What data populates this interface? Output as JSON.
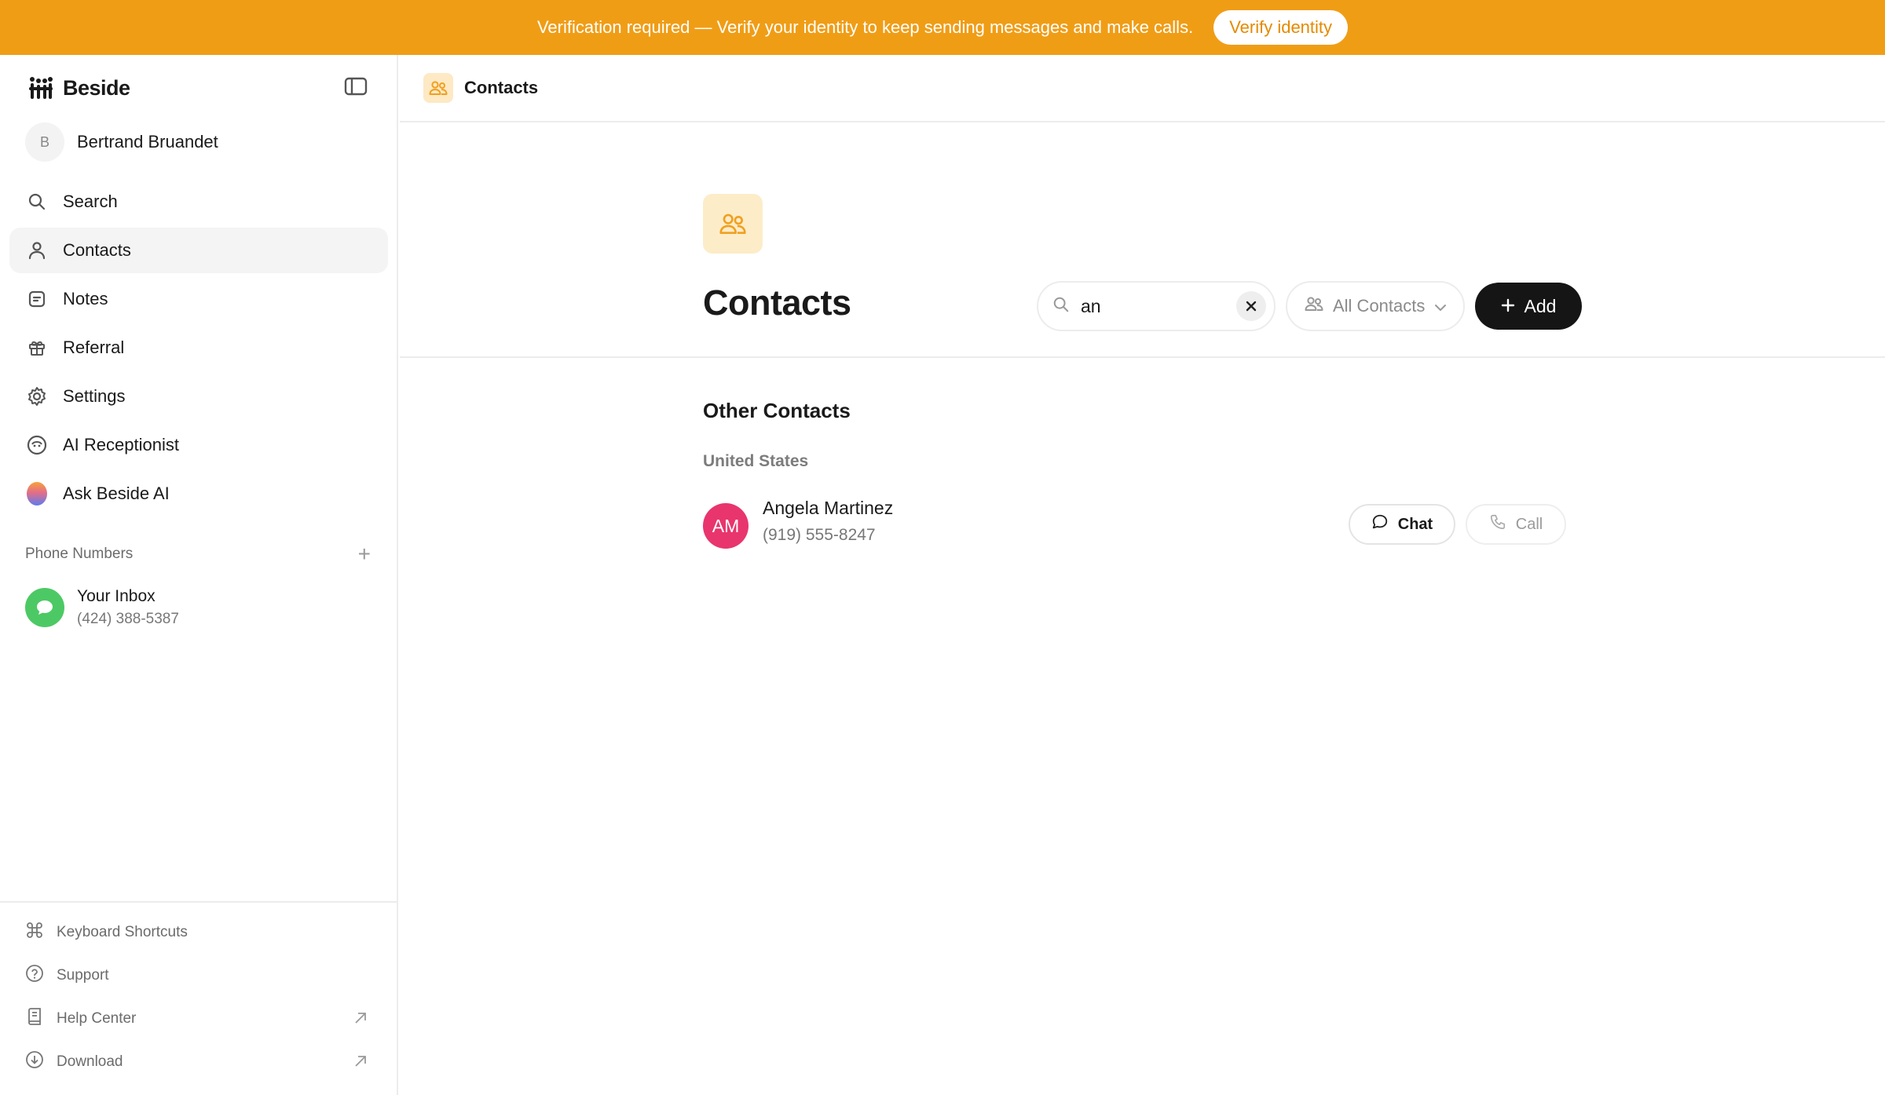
{
  "banner": {
    "text": "Verification required — Verify your identity to keep sending messages and make calls.",
    "button_label": "Verify identity"
  },
  "sidebar": {
    "brand": "Beside",
    "user": {
      "initial": "B",
      "name": "Bertrand Bruandet"
    },
    "items": [
      {
        "label": "Search",
        "icon": "search-icon"
      },
      {
        "label": "Contacts",
        "icon": "person-icon",
        "active": true
      },
      {
        "label": "Notes",
        "icon": "note-icon"
      },
      {
        "label": "Referral",
        "icon": "gift-icon"
      },
      {
        "label": "Settings",
        "icon": "gear-icon"
      },
      {
        "label": "AI Receptionist",
        "icon": "receptionist-icon"
      },
      {
        "label": "Ask Beside AI",
        "icon": "ai-orb-icon"
      }
    ],
    "phone_numbers_title": "Phone Numbers",
    "inbox": {
      "name": "Your Inbox",
      "number": "(424) 388-5387"
    },
    "footer": [
      {
        "label": "Keyboard Shortcuts",
        "icon": "command-icon"
      },
      {
        "label": "Support",
        "icon": "help-circle-icon"
      },
      {
        "label": "Help Center",
        "icon": "book-icon",
        "external": true
      },
      {
        "label": "Download",
        "icon": "download-icon",
        "external": true
      }
    ]
  },
  "topbar": {
    "title": "Contacts"
  },
  "page": {
    "title": "Contacts",
    "search_value": "an",
    "filter_label": "All Contacts",
    "add_label": "Add",
    "group_title": "Other Contacts",
    "region": "United States"
  },
  "contacts": [
    {
      "initials": "AM",
      "name": "Angela Martinez",
      "phone": "(919) 555-8247",
      "chat_label": "Chat",
      "call_label": "Call",
      "avatar_color": "#e8356d"
    }
  ],
  "colors": {
    "banner": "#f09d16",
    "accent_soft": "#fdecc8",
    "primary_button": "#151515"
  }
}
